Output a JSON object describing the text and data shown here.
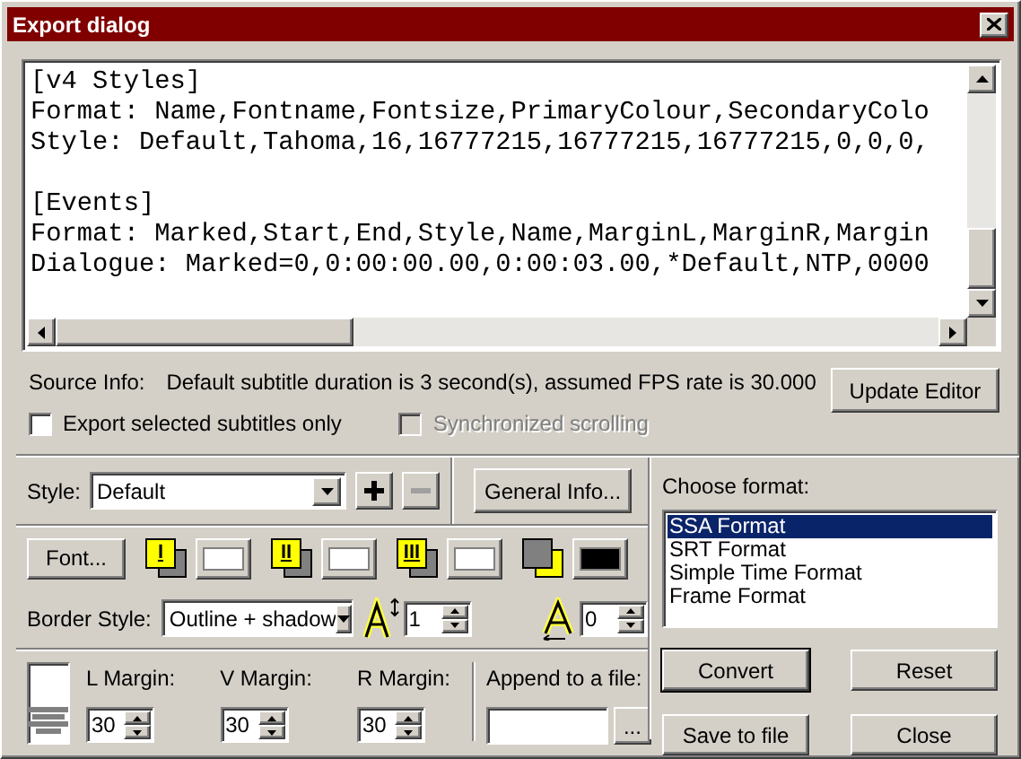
{
  "window": {
    "title": "Export dialog"
  },
  "preview": {
    "blocks": [
      {
        "lines": [
          "[v4 Styles]",
          "Format: Name,Fontname,Fontsize,PrimaryColour,SecondaryColo",
          "Style: Default,Tahoma,16,16777215,16777215,16777215,0,0,0,"
        ]
      },
      {
        "lines": [
          "[Events]",
          "Format: Marked,Start,End,Style,Name,MarginL,MarginR,Margin",
          "Dialogue: Marked=0,0:00:00.00,0:00:03.00,*Default,NTP,0000"
        ]
      }
    ]
  },
  "source_info": {
    "label": "Source Info:",
    "text": "Default subtitle duration is 3 second(s), assumed FPS rate is 30.000"
  },
  "update_button": "Update Editor",
  "checkboxes": [
    {
      "label": "Export selected subtitles only",
      "checked": false,
      "disabled": false
    },
    {
      "label": "Synchronized scrolling",
      "checked": false,
      "disabled": true
    }
  ],
  "style": {
    "label": "Style:",
    "value": "Default"
  },
  "style_buttons": [
    {
      "kind": "add",
      "disabled": false
    },
    {
      "kind": "remove",
      "disabled": true
    }
  ],
  "general_info_button": "General Info...",
  "font_button": "Font...",
  "color_slots": [
    {
      "kind": "numbered",
      "label": "I",
      "color": "#ffffff"
    },
    {
      "kind": "numbered",
      "label": "II",
      "color": "#ffffff"
    },
    {
      "kind": "numbered",
      "label": "III",
      "color": "#ffffff"
    },
    {
      "kind": "shadow",
      "color": "#000000"
    }
  ],
  "border_style": {
    "label": "Border Style:",
    "value": "Outline + shadow"
  },
  "outline": {
    "value": "1"
  },
  "shadow": {
    "value": "0"
  },
  "margins": [
    {
      "label": "L Margin:",
      "value": "30"
    },
    {
      "label": "V Margin:",
      "value": "30"
    },
    {
      "label": "R Margin:",
      "value": "30"
    }
  ],
  "append": {
    "label": "Append to a file:",
    "browse": "..."
  },
  "formats": {
    "label": "Choose format:",
    "items": [
      {
        "label": "SSA Format",
        "selected": true
      },
      {
        "label": "SRT Format",
        "selected": false
      },
      {
        "label": "Simple Time Format",
        "selected": false
      },
      {
        "label": "Frame Format",
        "selected": false
      }
    ]
  },
  "buttons": [
    {
      "label": "Convert",
      "default": true
    },
    {
      "label": "Reset",
      "default": false
    },
    {
      "label": "Save to file",
      "default": false
    },
    {
      "label": "Close",
      "default": false
    }
  ]
}
